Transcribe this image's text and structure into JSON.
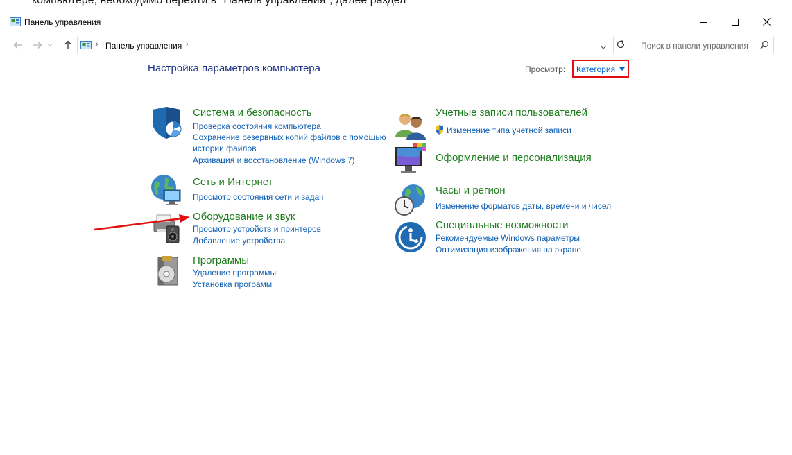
{
  "article_text": "компьютере, необходимо перейти в \"Панель управления\", далее раздел",
  "window": {
    "title": "Панель управления",
    "minimize": "—",
    "maximize": "☐",
    "close": "✕"
  },
  "addressbar": {
    "breadcrumb": "Панель управления",
    "separator": "›",
    "search_placeholder": "Поиск в панели управления"
  },
  "main": {
    "heading": "Настройка параметров компьютера",
    "view_label": "Просмотр:",
    "view_value": "Категория"
  },
  "categories": {
    "system": {
      "title": "Система и безопасность",
      "links": [
        "Проверка состояния компьютера",
        "Сохранение резервных копий файлов с помощью",
        "истории файлов",
        "Архивация и восстановление (Windows 7)"
      ]
    },
    "network": {
      "title": "Сеть и Интернет",
      "links": [
        "Просмотр состояния сети и задач"
      ]
    },
    "hardware": {
      "title": "Оборудование и звук",
      "links": [
        "Просмотр устройств и принтеров",
        "Добавление устройства"
      ]
    },
    "programs": {
      "title": "Программы",
      "links": [
        "Удаление программы",
        "Установка программ"
      ]
    },
    "accounts": {
      "title": "Учетные записи пользователей",
      "links": [
        "Изменение типа учетной записи"
      ]
    },
    "appearance": {
      "title": "Оформление и персонализация",
      "links": []
    },
    "clock": {
      "title": "Часы и регион",
      "links": [
        "Изменение форматов даты, времени и чисел"
      ]
    },
    "access": {
      "title": "Специальные возможности",
      "links": [
        "Рекомендуемые Windows параметры",
        "Оптимизация изображения на экране"
      ]
    }
  },
  "colors": {
    "heading": "#1e3287",
    "category_title": "#1e7d1e",
    "link": "#0f5fb4",
    "highlight": "#e01010"
  },
  "icons": {
    "app": "control-panel-icon",
    "system": "shield-icon",
    "network": "globe-network-icon",
    "hardware": "printer-speaker-icon",
    "programs": "disc-box-icon",
    "accounts": "users-icon",
    "appearance": "monitor-palette-icon",
    "clock": "clock-globe-icon",
    "access": "accessibility-icon"
  }
}
